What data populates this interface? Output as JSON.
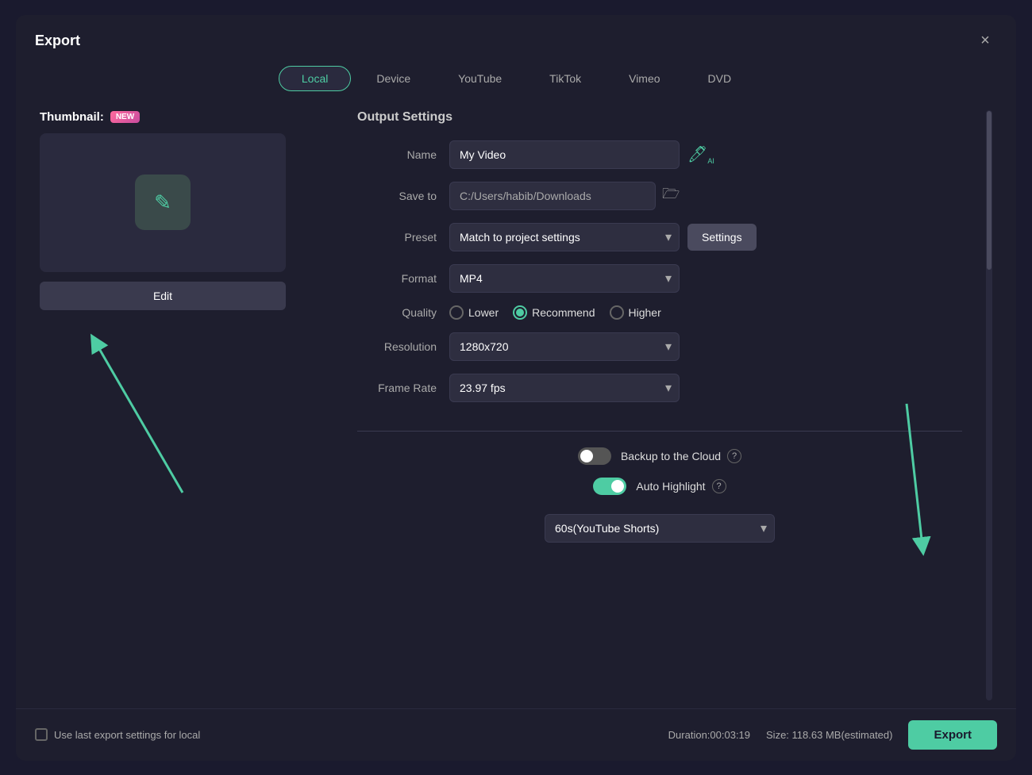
{
  "dialog": {
    "title": "Export",
    "close_label": "×"
  },
  "tabs": [
    {
      "id": "local",
      "label": "Local",
      "active": true
    },
    {
      "id": "device",
      "label": "Device",
      "active": false
    },
    {
      "id": "youtube",
      "label": "YouTube",
      "active": false
    },
    {
      "id": "tiktok",
      "label": "TikTok",
      "active": false
    },
    {
      "id": "vimeo",
      "label": "Vimeo",
      "active": false
    },
    {
      "id": "dvd",
      "label": "DVD",
      "active": false
    }
  ],
  "thumbnail": {
    "label": "Thumbnail:",
    "badge": "NEW",
    "edit_label": "Edit"
  },
  "output_settings": {
    "title": "Output Settings",
    "name_label": "Name",
    "name_value": "My Video",
    "saveto_label": "Save to",
    "saveto_value": "C:/Users/habib/Downloads",
    "preset_label": "Preset",
    "preset_value": "Match to project settings",
    "settings_label": "Settings",
    "format_label": "Format",
    "format_value": "MP4",
    "quality_label": "Quality",
    "quality_options": [
      {
        "id": "lower",
        "label": "Lower",
        "checked": false
      },
      {
        "id": "recommend",
        "label": "Recommend",
        "checked": true
      },
      {
        "id": "higher",
        "label": "Higher",
        "checked": false
      }
    ],
    "resolution_label": "Resolution",
    "resolution_value": "1280x720",
    "framerate_label": "Frame Rate",
    "framerate_value": "23.97 fps",
    "backup_label": "Backup to the Cloud",
    "backup_enabled": false,
    "autohighlight_label": "Auto Highlight",
    "autohighlight_enabled": true,
    "shorts_value": "60s(YouTube Shorts)",
    "help_label": "?"
  },
  "footer": {
    "last_export_label": "Use last export settings for local",
    "duration_label": "Duration:",
    "duration_value": "00:03:19",
    "size_label": "Size:",
    "size_value": "118.63 MB(estimated)",
    "export_label": "Export"
  }
}
